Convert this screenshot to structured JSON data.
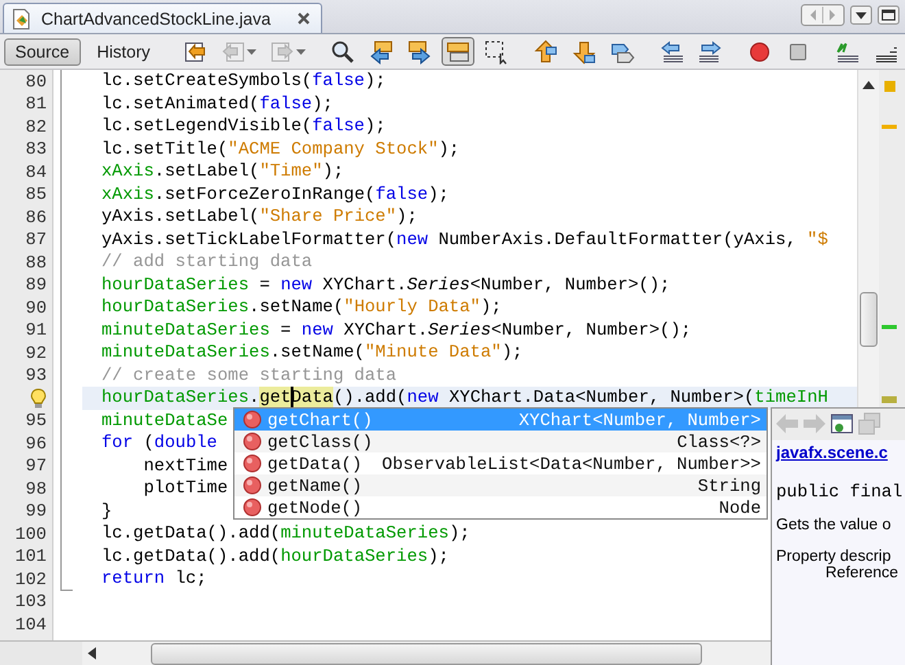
{
  "tab": {
    "title": "ChartAdvancedStockLine.java",
    "selected": true
  },
  "view_buttons": [
    {
      "label": "Source",
      "selected": true
    },
    {
      "label": "History",
      "selected": false
    }
  ],
  "toolbar": {
    "groups": [
      [
        {
          "kind": "last-edit",
          "pressed": false,
          "disabled": false
        },
        {
          "kind": "back",
          "pressed": false,
          "disabled": true
        },
        {
          "kind": "forward",
          "pressed": false,
          "disabled": true
        }
      ],
      [
        {
          "kind": "find",
          "pressed": false,
          "disabled": false
        },
        {
          "kind": "find-previous",
          "pressed": false,
          "disabled": false
        },
        {
          "kind": "find-next",
          "pressed": false,
          "disabled": false
        },
        {
          "kind": "highlight",
          "pressed": true,
          "disabled": false
        },
        {
          "kind": "rect-select",
          "pressed": false,
          "disabled": false
        }
      ],
      [
        {
          "kind": "previous-bookmark",
          "pressed": false,
          "disabled": false
        },
        {
          "kind": "next-bookmark",
          "pressed": false,
          "disabled": false
        },
        {
          "kind": "toggle-bookmark",
          "pressed": false,
          "disabled": false
        }
      ],
      [
        {
          "kind": "shift-left",
          "pressed": false,
          "disabled": false
        },
        {
          "kind": "shift-right",
          "pressed": false,
          "disabled": false
        }
      ],
      [
        {
          "kind": "record",
          "pressed": false,
          "disabled": false
        },
        {
          "kind": "stop",
          "pressed": false,
          "disabled": false
        }
      ],
      [
        {
          "kind": "comment",
          "pressed": false,
          "disabled": false
        },
        {
          "kind": "uncomment",
          "pressed": false,
          "disabled": false
        }
      ]
    ]
  },
  "editor": {
    "lines": [
      {
        "number": "80",
        "current": false,
        "hint": false,
        "tokens": [
          {
            "t": "lc.setCreateSymbols(",
            "kind": "plain"
          },
          {
            "t": "false",
            "kind": "keyword"
          },
          {
            "t": ");",
            "kind": "plain"
          }
        ]
      },
      {
        "number": "81",
        "current": false,
        "hint": false,
        "tokens": [
          {
            "t": "lc.setAnimated(",
            "kind": "plain"
          },
          {
            "t": "false",
            "kind": "keyword"
          },
          {
            "t": ");",
            "kind": "plain"
          }
        ]
      },
      {
        "number": "82",
        "current": false,
        "hint": false,
        "tokens": [
          {
            "t": "lc.setLegendVisible(",
            "kind": "plain"
          },
          {
            "t": "false",
            "kind": "keyword"
          },
          {
            "t": ");",
            "kind": "plain"
          }
        ]
      },
      {
        "number": "83",
        "current": false,
        "hint": false,
        "tokens": [
          {
            "t": "lc.setTitle(",
            "kind": "plain"
          },
          {
            "t": "\"ACME Company Stock\"",
            "kind": "string"
          },
          {
            "t": ");",
            "kind": "plain"
          }
        ]
      },
      {
        "number": "84",
        "current": false,
        "hint": false,
        "tokens": [
          {
            "t": "xAxis",
            "kind": "field"
          },
          {
            "t": ".setLabel(",
            "kind": "plain"
          },
          {
            "t": "\"Time\"",
            "kind": "string"
          },
          {
            "t": ");",
            "kind": "plain"
          }
        ]
      },
      {
        "number": "85",
        "current": false,
        "hint": false,
        "tokens": [
          {
            "t": "xAxis",
            "kind": "field"
          },
          {
            "t": ".setForceZeroInRange(",
            "kind": "plain"
          },
          {
            "t": "false",
            "kind": "keyword"
          },
          {
            "t": ");",
            "kind": "plain"
          }
        ]
      },
      {
        "number": "86",
        "current": false,
        "hint": false,
        "tokens": [
          {
            "t": "yAxis.setLabel(",
            "kind": "plain"
          },
          {
            "t": "\"Share Price\"",
            "kind": "string"
          },
          {
            "t": ");",
            "kind": "plain"
          }
        ]
      },
      {
        "number": "87",
        "current": false,
        "hint": false,
        "tokens": [
          {
            "t": "yAxis.setTickLabelFormatter(",
            "kind": "plain"
          },
          {
            "t": "new",
            "kind": "keyword"
          },
          {
            "t": " NumberAxis.DefaultFormatter(yAxis, ",
            "kind": "plain"
          },
          {
            "t": "\"$",
            "kind": "string"
          }
        ]
      },
      {
        "number": "88",
        "current": false,
        "hint": false,
        "tokens": [
          {
            "t": "// add starting data",
            "kind": "comment"
          }
        ]
      },
      {
        "number": "89",
        "current": false,
        "hint": false,
        "tokens": [
          {
            "t": "hourDataSeries",
            "kind": "field"
          },
          {
            "t": " = ",
            "kind": "plain"
          },
          {
            "t": "new",
            "kind": "keyword"
          },
          {
            "t": " XYChart.",
            "kind": "plain"
          },
          {
            "t": "Series",
            "kind": "italic"
          },
          {
            "t": "<Number, Number>();",
            "kind": "plain"
          }
        ]
      },
      {
        "number": "90",
        "current": false,
        "hint": false,
        "tokens": [
          {
            "t": "hourDataSeries",
            "kind": "field"
          },
          {
            "t": ".setName(",
            "kind": "plain"
          },
          {
            "t": "\"Hourly Data\"",
            "kind": "string"
          },
          {
            "t": ");",
            "kind": "plain"
          }
        ]
      },
      {
        "number": "91",
        "current": false,
        "hint": false,
        "tokens": [
          {
            "t": "minuteDataSeries",
            "kind": "field"
          },
          {
            "t": " = ",
            "kind": "plain"
          },
          {
            "t": "new",
            "kind": "keyword"
          },
          {
            "t": " XYChart.",
            "kind": "plain"
          },
          {
            "t": "Series",
            "kind": "italic"
          },
          {
            "t": "<Number, Number>();",
            "kind": "plain"
          }
        ]
      },
      {
        "number": "92",
        "current": false,
        "hint": false,
        "tokens": [
          {
            "t": "minuteDataSeries",
            "kind": "field"
          },
          {
            "t": ".setName(",
            "kind": "plain"
          },
          {
            "t": "\"Minute Data\"",
            "kind": "string"
          },
          {
            "t": ");",
            "kind": "plain"
          }
        ]
      },
      {
        "number": "93",
        "current": false,
        "hint": false,
        "tokens": [
          {
            "t": "// create some starting data",
            "kind": "comment"
          }
        ]
      },
      {
        "current": true,
        "hint": true,
        "tokens": [
          {
            "t": "hourDataSeries",
            "kind": "field"
          },
          {
            "t": ".",
            "kind": "plain"
          },
          {
            "t": "get",
            "kind": "match"
          },
          {
            "t": "Data",
            "kind": "caret-match"
          },
          {
            "t": "().add(",
            "kind": "plain"
          },
          {
            "t": "new",
            "kind": "keyword"
          },
          {
            "t": " XYChart.Data<Number, Number>(",
            "kind": "plain"
          },
          {
            "t": "timeInH",
            "kind": "field"
          }
        ]
      },
      {
        "number": "95",
        "current": false,
        "hint": false,
        "tokens": [
          {
            "t": "minuteDataSe",
            "kind": "field"
          }
        ]
      },
      {
        "number": "96",
        "current": false,
        "hint": false,
        "tokens": [
          {
            "t": "for",
            "kind": "keyword"
          },
          {
            "t": " (",
            "kind": "plain"
          },
          {
            "t": "double",
            "kind": "keyword"
          }
        ]
      },
      {
        "number": "97",
        "current": false,
        "hint": false,
        "tokens": [
          {
            "t": "    nextTime",
            "kind": "plain"
          }
        ]
      },
      {
        "number": "98",
        "current": false,
        "hint": false,
        "tokens": [
          {
            "t": "    plotTime",
            "kind": "plain"
          }
        ]
      },
      {
        "number": "99",
        "current": false,
        "hint": false,
        "tokens": [
          {
            "t": "}",
            "kind": "plain"
          }
        ]
      },
      {
        "number": "100",
        "current": false,
        "hint": false,
        "tokens": [
          {
            "t": "lc.getData().add(",
            "kind": "plain"
          },
          {
            "t": "minuteDataSeries",
            "kind": "field"
          },
          {
            "t": ");",
            "kind": "plain"
          }
        ]
      },
      {
        "number": "101",
        "current": false,
        "hint": false,
        "tokens": [
          {
            "t": "lc.getData().add(",
            "kind": "plain"
          },
          {
            "t": "hourDataSeries",
            "kind": "field"
          },
          {
            "t": ");",
            "kind": "plain"
          }
        ]
      },
      {
        "number": "102",
        "current": false,
        "hint": false,
        "tokens": [
          {
            "t": "return",
            "kind": "keyword"
          },
          {
            "t": " lc;",
            "kind": "plain"
          }
        ]
      },
      {
        "number": "103",
        "current": false,
        "hint": false
      },
      {
        "number": "104",
        "current": false,
        "hint": false
      }
    ]
  },
  "completion": {
    "items": [
      {
        "name": "getChart()",
        "type": "XYChart<Number, Number>",
        "selected": true
      },
      {
        "name": "getClass()",
        "type": "Class<?>",
        "selected": false
      },
      {
        "name": "getData()",
        "type": "ObservableList<Data<Number, Number>>",
        "selected": false
      },
      {
        "name": "getName()",
        "type": "String",
        "selected": false
      },
      {
        "name": "getNode()",
        "type": "Node",
        "selected": false
      }
    ]
  },
  "javadoc": {
    "nav": [
      {
        "kind": "back",
        "disabled": true
      },
      {
        "kind": "forward",
        "disabled": true
      },
      {
        "kind": "browser",
        "disabled": false
      },
      {
        "kind": "copy",
        "disabled": true
      }
    ],
    "link": "javafx.scene.c",
    "signature": "public final",
    "description": "Gets the value o",
    "property_label": "Property descrip",
    "reference": "Reference"
  }
}
